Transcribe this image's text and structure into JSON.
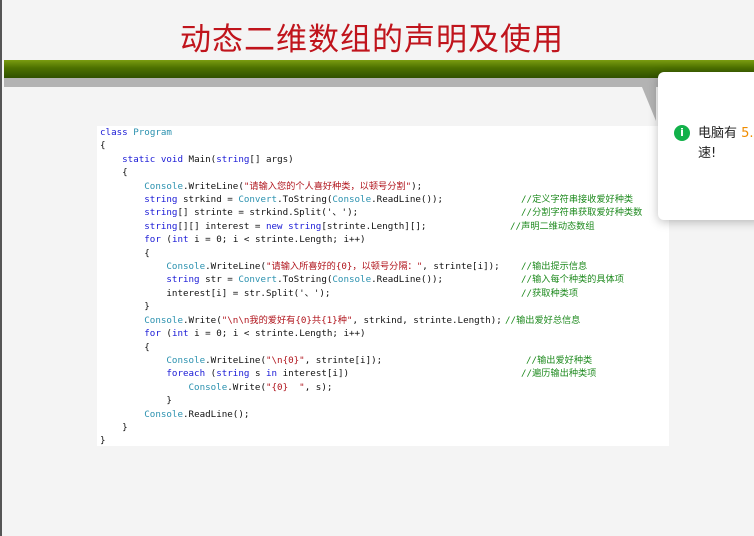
{
  "slide": {
    "title": "动态二维数组的声明及使用"
  },
  "code": {
    "l1": {
      "kw": "class",
      "name": "Program"
    },
    "l2": "{",
    "l3": {
      "kw": "static void",
      "sig": "Main(",
      "type": "string",
      "rest": "[] args)"
    },
    "l4": "{",
    "l5": {
      "cls": "Console",
      "call": ".WriteLine(",
      "str": "\"请输入您的个人喜好种类，以顿号分割\"",
      "end": ");"
    },
    "l6": {
      "kw": "string",
      "a": " strkind = ",
      "cls": "Convert",
      "b": ".ToString(",
      "cls2": "Console",
      "c": ".ReadLine());",
      "comment": "//定义字符串接收爱好种类"
    },
    "l7": {
      "kw": "string",
      "a": "[] strinte = strkind.Split('、');",
      "comment": "//分割字符串获取爱好种类数"
    },
    "l8": {
      "kw": "string",
      "a": "[][] interest = ",
      "kw2": "new string",
      "b": "[strinte.Length][];",
      "comment": "//声明二维动态数组"
    },
    "l9": {
      "kw": "for",
      "a": " (",
      "kw2": "int",
      "b": " i = 0; i < strinte.Length; i++)"
    },
    "l10": "{",
    "l11": {
      "cls": "Console",
      "call": ".WriteLine(",
      "str": "\"请输入所喜好的{0}，以顿号分隔：\"",
      "end": ", strinte[i]);",
      "comment": "//输出提示信息"
    },
    "l12": {
      "kw": "string",
      "a": " str = ",
      "cls": "Convert",
      "b": ".ToString(",
      "cls2": "Console",
      "c": ".ReadLine());",
      "comment": "//输入每个种类的具体项"
    },
    "l13": {
      "a": "interest[i] = str.Split('、');",
      "comment": "//获取种类项"
    },
    "l14": "}",
    "l15": {
      "cls": "Console",
      "call": ".Write(",
      "str": "\"\\n\\n我的爱好有{0}共{1}种\"",
      "end": ", strkind, strinte.Length);",
      "comment": "//输出爱好总信息"
    },
    "l16": {
      "kw": "for",
      "a": " (",
      "kw2": "int",
      "b": " i = 0; i < strinte.Length; i++)"
    },
    "l17": "{",
    "l18": {
      "cls": "Console",
      "call": ".WriteLine(",
      "str": "\"\\n{0}\"",
      "end": ", strinte[i]);",
      "comment": "//输出爱好种类"
    },
    "l19": {
      "kw": "foreach",
      "a": " (",
      "kw2": "string",
      "b": " s ",
      "kw3": "in",
      "c": " interest[i])",
      "comment": "//遍历输出种类项"
    },
    "l20": {
      "cls": "Console",
      "call": ".Write(",
      "str": "\"{0}  \"",
      "end": ", s);"
    },
    "l21": "}",
    "l22": {
      "cls": "Console",
      "call": ".ReadLine();"
    },
    "l23": "}",
    "l24": "}"
  },
  "toast": {
    "icon": "info-icon",
    "icon_color": "#12b14a",
    "text_before": "电脑有 ",
    "highlight": "5.",
    "text_line2": "速!"
  }
}
